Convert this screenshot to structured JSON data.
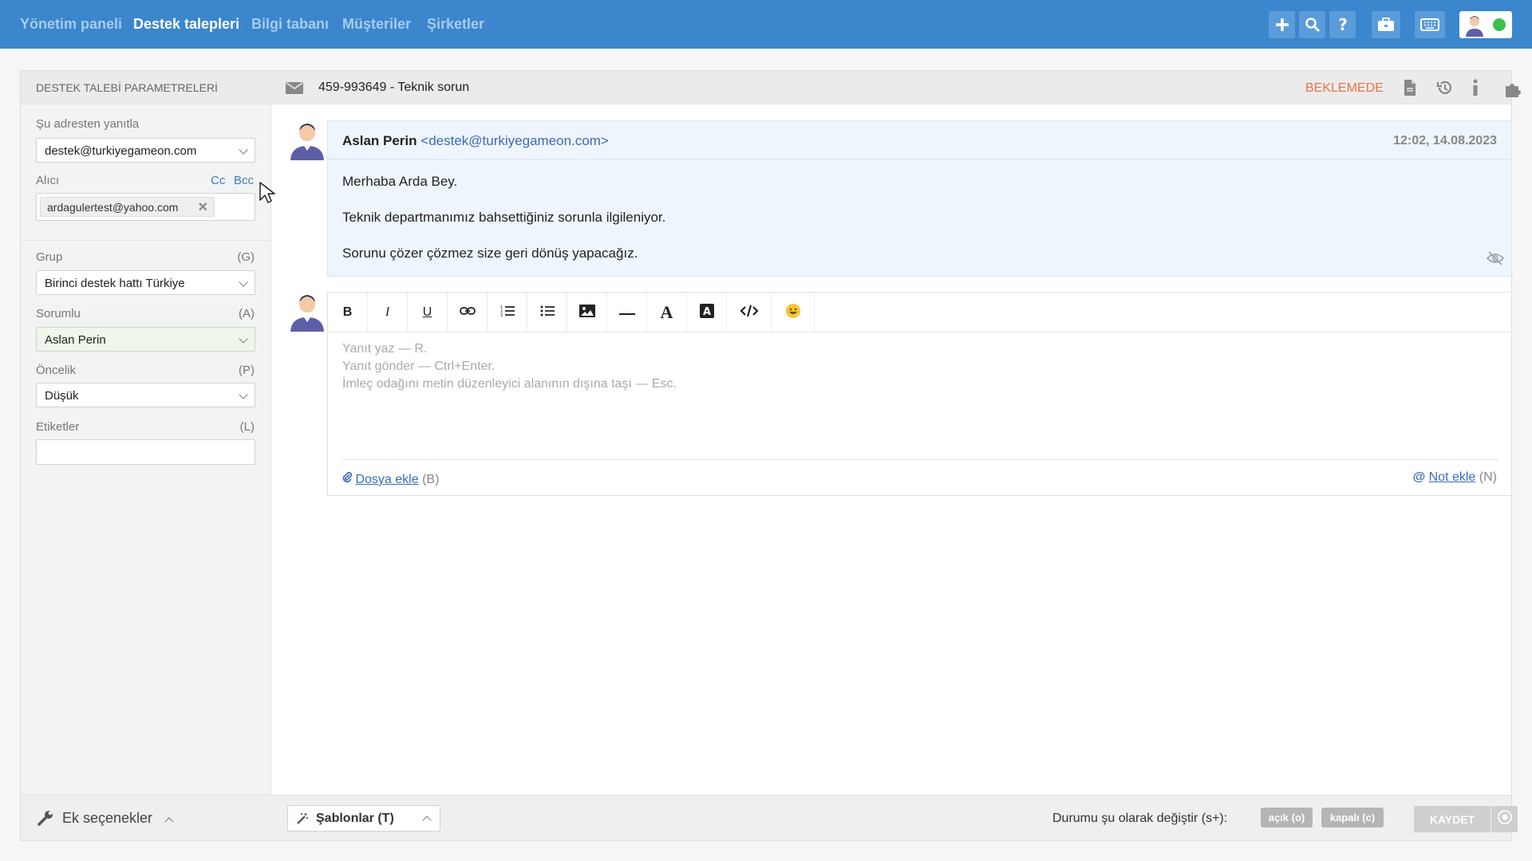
{
  "nav": {
    "items": [
      "Yönetim paneli",
      "Destek talepleri",
      "Bilgi tabanı",
      "Müşteriler",
      "Şirketler"
    ],
    "active_index": 1
  },
  "topbar_icons": [
    "plus-icon",
    "search-icon",
    "help-icon",
    "briefcase-icon",
    "keyboard-icon"
  ],
  "user_status": "online",
  "sidebar": {
    "title": "DESTEK TALEBİ PARAMETRELERİ",
    "reply_from": {
      "label": "Şu adresten yanıtla",
      "value": "destek@turkiyegameon.com"
    },
    "recipient": {
      "label": "Alıcı",
      "cc": "Cc",
      "bcc": "Bcc",
      "chip": "ardagulertest@yahoo.com"
    },
    "group": {
      "label": "Grup",
      "hotkey": "(G)",
      "value": "Birinci destek hattı Türkiye"
    },
    "assignee": {
      "label": "Sorumlu",
      "hotkey": "(A)",
      "value": "Aslan Perin"
    },
    "priority": {
      "label": "Öncelik",
      "hotkey": "(P)",
      "value": "Düşük"
    },
    "tags": {
      "label": "Etiketler",
      "hotkey": "(L)",
      "value": ""
    },
    "extra_options": "Ek seçenekler"
  },
  "ticket": {
    "title": "459-993649 - Teknik sorun",
    "status": "BEKLEMEDE"
  },
  "message": {
    "author": "Aslan Perin",
    "email": "<destek@turkiyegameon.com>",
    "time": "12:02, 14.08.2023",
    "lines": [
      "Merhaba Arda Bey.",
      "Teknik departmanımız bahsettiğiniz sorunla ilgileniyor.",
      "Sorunu çözer çözmez size geri dönüş yapacağız."
    ]
  },
  "editor": {
    "toolbar": [
      "bold",
      "italic",
      "underline",
      "link",
      "ordered-list",
      "bullet-list",
      "image",
      "horizontal-rule",
      "font-color",
      "background-color",
      "code",
      "emoji"
    ],
    "placeholder_lines": [
      "Yanıt yaz — R.",
      "Yanıt gönder — Ctrl+Enter.",
      "İmleç odağını metin düzenleyici alanının dışına taşı — Esc."
    ],
    "attach_label": "Dosya ekle",
    "attach_hotkey": "(B)",
    "note_label": "Not ekle",
    "note_hotkey": "(N)"
  },
  "footer": {
    "templates": "Şablonlar (T)",
    "status_label": "Durumu şu olarak değiştir (s+):",
    "open": "açık (o)",
    "closed": "kapalı (c)",
    "save": "KAYDET"
  },
  "colors": {
    "nav_bg": "#3b86cc",
    "status_pending": "#e8734a",
    "link": "#3a6cb5"
  }
}
